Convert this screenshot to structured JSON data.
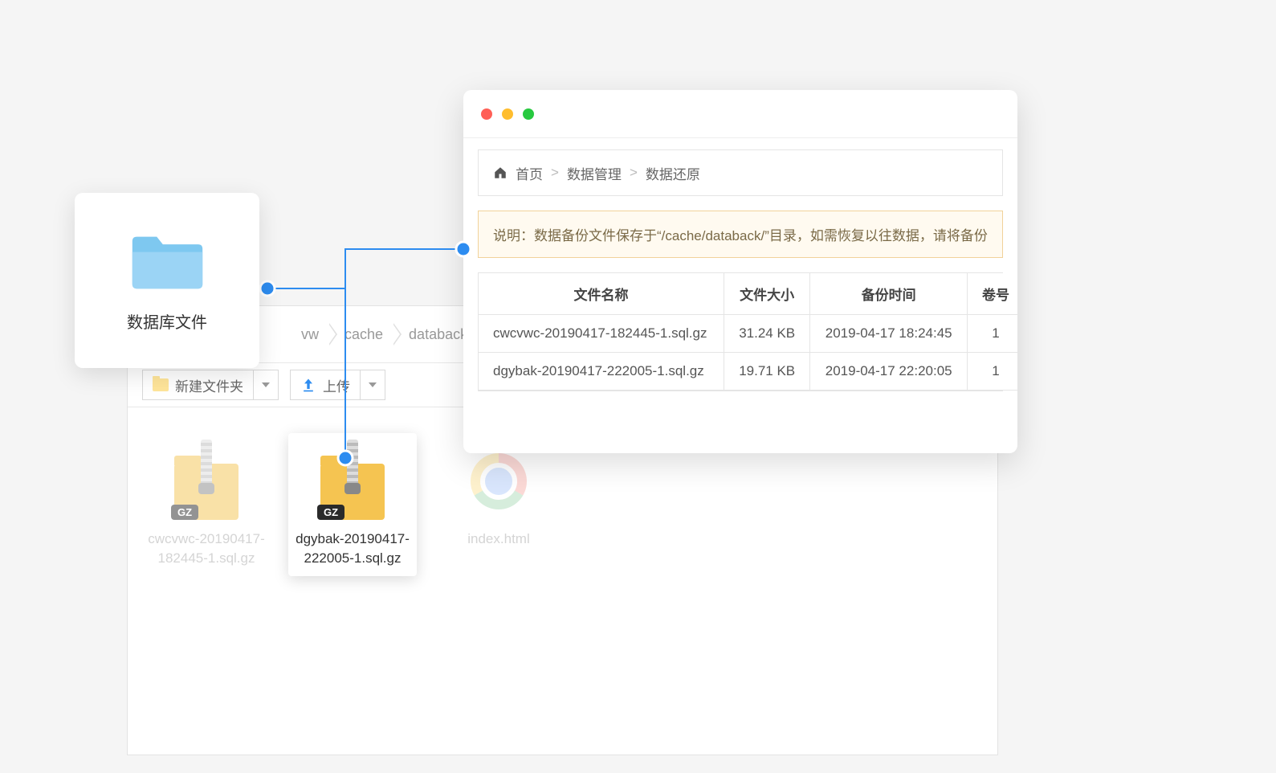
{
  "db_card": {
    "label": "数据库文件"
  },
  "file_manager": {
    "path_segments": [
      "vw",
      "cache",
      "databack"
    ],
    "toolbar": {
      "new_folder_label": "新建文件夹",
      "upload_label": "上传"
    },
    "files": [
      {
        "name": "cwcvwc-20190417-182445-1.sql.gz",
        "type": "gz",
        "badge": "GZ",
        "selected": false,
        "dimmed": true
      },
      {
        "name": "dgybak-20190417-222005-1.sql.gz",
        "type": "gz",
        "badge": "GZ",
        "selected": true,
        "dimmed": false
      },
      {
        "name": "index.html",
        "type": "chrome",
        "selected": false,
        "dimmed": true
      }
    ]
  },
  "browser": {
    "breadcrumb": {
      "home": "首页",
      "sep": ">",
      "level1": "数据管理",
      "level2": "数据还原"
    },
    "notice": "说明：数据备份文件保存于“/cache/databack/”目录，如需恢复以往数据，请将备份",
    "table": {
      "headers": [
        "文件名称",
        "文件大小",
        "备份时间",
        "卷号"
      ],
      "rows": [
        {
          "name": "cwcvwc-20190417-182445-1.sql.gz",
          "size": "31.24 KB",
          "time": "2019-04-17 18:24:45",
          "vol": "1"
        },
        {
          "name": "dgybak-20190417-222005-1.sql.gz",
          "size": "19.71 KB",
          "time": "2019-04-17 22:20:05",
          "vol": "1"
        }
      ]
    }
  }
}
